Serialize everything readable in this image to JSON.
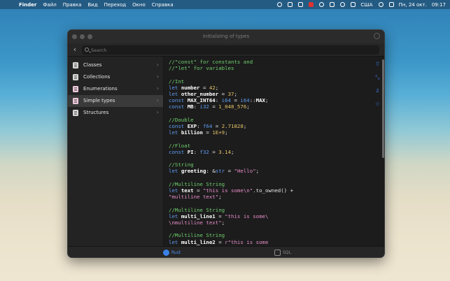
{
  "menubar": {
    "apple_icon": "",
    "app_name": "Finder",
    "menus": [
      "Файл",
      "Правка",
      "Вид",
      "Переход",
      "Окно",
      "Справка"
    ],
    "status": {
      "input_lang": "США",
      "datetime_label": "Пн, 24 окт.",
      "time": "09:17"
    },
    "icons": [
      "vpn-icon",
      "menu-extra-icon",
      "mute-icon",
      "record-icon",
      "wifi-icon",
      "bluetooth-icon",
      "user-icon",
      "keyboard-icon",
      "control-center-icon",
      "siri-icon"
    ]
  },
  "window": {
    "title": "Initializing of types",
    "search": {
      "placeholder": "Search",
      "value": ""
    },
    "sidebar": {
      "items": [
        {
          "label": "Classes",
          "selected": false,
          "icon": "doc-icon"
        },
        {
          "label": "Collections",
          "selected": false,
          "icon": "doc-icon"
        },
        {
          "label": "Enumerations",
          "selected": false,
          "icon": "doc-icon-pink"
        },
        {
          "label": "Simple types",
          "selected": true,
          "icon": "doc-icon-pink"
        },
        {
          "label": "Structures",
          "selected": false,
          "icon": "doc-icon"
        }
      ]
    },
    "code": {
      "lines": [
        "//\"const\" for constants and",
        "//\"let\" for variables",
        "",
        "//Int",
        "let number = 42;",
        "let other_number = 37;",
        "const MAX_INT64: i64 = i64::MAX;",
        "const MB: i32 = 1_048_576;",
        "",
        "//Double",
        "const EXP: f64 = 2.71828;",
        "let billion = 1E+9;",
        "",
        "//Float",
        "const PI: f32 = 3.14;",
        "",
        "//String",
        "let greeting: &str = \"Hello\";",
        "",
        "//Multiline String",
        "let text = \"this is some\\n\".to_owned() +",
        "\"multiline text\";",
        "",
        "//Multiline String",
        "let multi_line1 = \"this is some\\",
        "\\nmultiline text\";",
        "",
        "//Multiline String",
        "let multi_line2 = r\"this is some"
      ]
    },
    "right_icons": [
      "share-icon",
      "fullscreen-icon",
      "sort-icon",
      "star-icon"
    ],
    "tabs": [
      {
        "label": "Rust",
        "selected": true
      },
      {
        "label": "SQL",
        "selected": false
      }
    ]
  },
  "colors": {
    "comment": "#6fd16f",
    "keyword": "#5e9bf0",
    "number": "#e6c268",
    "string": "#e58cc8",
    "accent": "#3b82e6"
  }
}
